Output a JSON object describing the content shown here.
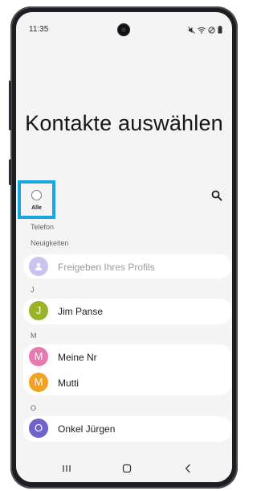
{
  "status_bar": {
    "time": "11:35"
  },
  "header": {
    "title": "Kontakte auswählen"
  },
  "select_all": {
    "label": "Alle"
  },
  "sections": {
    "telefon": "Telefon",
    "neuigkeiten": "Neuigkeiten",
    "j": "J",
    "m": "M",
    "o": "O"
  },
  "profile_share": {
    "label": "Freigeben Ihres Profils"
  },
  "contacts": {
    "jim": {
      "initial": "J",
      "name": "Jim Panse",
      "color": "#9ab32c"
    },
    "meine": {
      "initial": "M",
      "name": "Meine Nr",
      "color": "#e679b2"
    },
    "mutti": {
      "initial": "M",
      "name": "Mutti",
      "color": "#f4a11f"
    },
    "onkel": {
      "initial": "O",
      "name": "Onkel Jürgen",
      "color": "#6f62cc"
    }
  },
  "colors": {
    "highlight": "#1aa7df",
    "profile_avatar": "#cbc3ef"
  },
  "icons": {
    "search": "search-icon",
    "profile": "person-icon",
    "nav_recent": "recent-apps-icon",
    "nav_home": "home-icon",
    "nav_back": "back-icon"
  }
}
